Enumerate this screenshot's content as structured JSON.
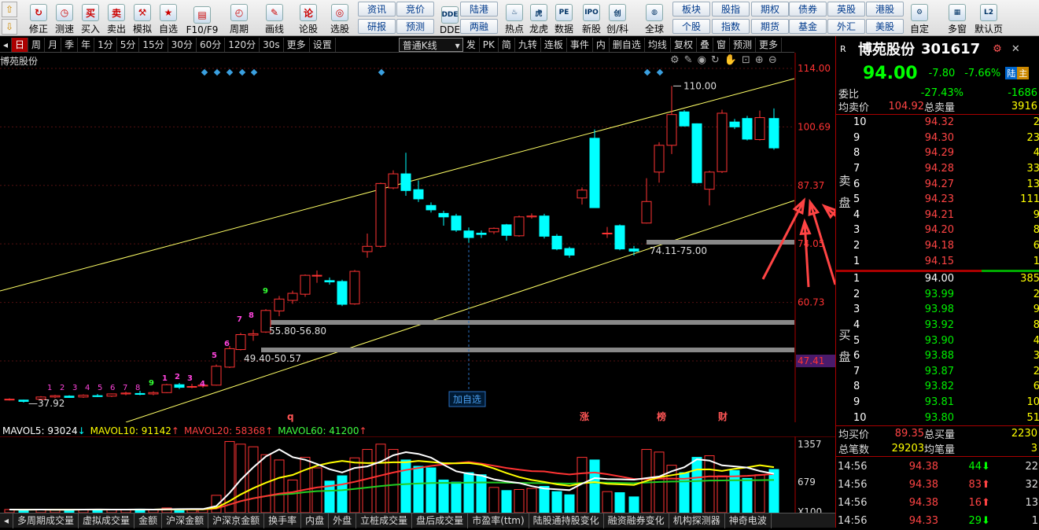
{
  "toolbar": {
    "buttons": [
      {
        "label": "修正",
        "icon": "refresh-icon",
        "glyph": "↻"
      },
      {
        "label": "测速",
        "icon": "stopwatch-icon",
        "glyph": "◷"
      },
      {
        "label": "买入",
        "icon": "buy-icon",
        "glyph": "买"
      },
      {
        "label": "卖出",
        "icon": "sell-icon",
        "glyph": "卖"
      },
      {
        "label": "模拟",
        "icon": "gavel-icon",
        "glyph": "⚒"
      },
      {
        "label": "自选",
        "icon": "star-icon",
        "glyph": "★"
      },
      {
        "label": "F10/F9",
        "icon": "f10-icon",
        "glyph": "▤"
      },
      {
        "label": "周期",
        "icon": "clock-icon",
        "glyph": "◴"
      },
      {
        "label": "画线",
        "icon": "pencil-icon",
        "glyph": "✎"
      },
      {
        "label": "论股",
        "icon": "discuss-icon",
        "glyph": "论"
      },
      {
        "label": "选股",
        "icon": "select-icon",
        "glyph": "◎"
      }
    ],
    "grid_buttons": [
      {
        "label": "资讯"
      },
      {
        "label": "竞价"
      },
      {
        "label": "研报"
      },
      {
        "label": "预测"
      },
      {
        "label": "陆港"
      },
      {
        "label": "两融"
      },
      {
        "label": "板块"
      },
      {
        "label": "股指"
      },
      {
        "label": "期权"
      },
      {
        "label": "债券"
      },
      {
        "label": "英股"
      },
      {
        "label": "港股"
      },
      {
        "label": "个股"
      },
      {
        "label": "指数"
      },
      {
        "label": "期货"
      },
      {
        "label": "基金"
      },
      {
        "label": "外汇"
      },
      {
        "label": "美股"
      }
    ],
    "icon_buttons_2": [
      {
        "label": "DDE",
        "glyph": "DDE"
      },
      {
        "label": "热点",
        "glyph": "♨"
      },
      {
        "label": "龙虎",
        "glyph": "虎"
      },
      {
        "label": "数据",
        "glyph": "PE"
      },
      {
        "label": "新股",
        "glyph": "IPO"
      },
      {
        "label": "创/科",
        "glyph": "创"
      },
      {
        "label": "全球",
        "glyph": "◍"
      },
      {
        "label": "自定",
        "glyph": "⚙"
      },
      {
        "label": "多窗",
        "glyph": "▦"
      },
      {
        "label": "默认页",
        "glyph": "L2"
      }
    ]
  },
  "period_bar": {
    "items": [
      "日",
      "周",
      "月",
      "季",
      "年",
      "1分",
      "5分",
      "15分",
      "30分",
      "60分",
      "120分",
      "30s",
      "更多",
      "设置"
    ],
    "active": "日",
    "kline_select": "普通K线",
    "right_items": [
      "发",
      "PK",
      "简",
      "九转",
      "连板",
      "事件",
      "内",
      "删自选",
      "均线",
      "复权",
      "叠",
      "窗",
      "预测",
      "更多"
    ]
  },
  "chart": {
    "stock_short": "博苑股份",
    "price_axis": [
      "114.00",
      "100.69",
      "87.37",
      "74.05",
      "60.73",
      "47.41"
    ],
    "price_marker": "47.41",
    "annotations": {
      "high": "110.00",
      "low": "37.92",
      "zone1": "74.11-75.00",
      "zone2": "55.80-56.80",
      "zone3": "49.40-50.57",
      "add_watch": "加自选"
    },
    "td_counts_pink": [
      "1",
      "2",
      "3",
      "4",
      "5",
      "6",
      "7",
      "8"
    ],
    "td_counts_green": [
      "9",
      "1",
      "2",
      "3",
      "4",
      "5",
      "6",
      "7",
      "8",
      "9"
    ],
    "event_marks": [
      "q",
      "涨",
      "榜",
      "财"
    ]
  },
  "volume": {
    "legend": [
      {
        "label": "MAVOL5: 93024",
        "dir": "↓",
        "color": "#ffffff"
      },
      {
        "label": "MAVOL10: 91142",
        "dir": "↑",
        "color": "#ffff00"
      },
      {
        "label": "MAVOL20: 58368",
        "dir": "↑",
        "color": "#ff4040"
      },
      {
        "label": "MAVOL60: 41200",
        "dir": "↑",
        "color": "#40ff40"
      }
    ],
    "axis": [
      "1357",
      "679",
      "X100"
    ]
  },
  "bottom_tabs": [
    "多周期成交量",
    "虚拟成交量",
    "金额",
    "沪深金额",
    "沪深京金额",
    "换手率",
    "内盘",
    "外盘",
    "立桩成交量",
    "盘后成交量",
    "市盈率(ttm)",
    "陆股通持股变化",
    "融资融券变化",
    "机构探测器",
    "神奇电波"
  ],
  "quote": {
    "flag": "R",
    "name": "博苑股份",
    "code": "301617",
    "price": "94.00",
    "change": "-7.80",
    "pct": "-7.66%",
    "tag1": "陆",
    "tag2": "主",
    "weibi_label": "委比",
    "weibi": "-27.43%",
    "weicha": "-1686",
    "avg_sell_label": "均卖价",
    "avg_sell": "104.92",
    "total_sell_label": "总卖量",
    "total_sell": "3916",
    "sell_side_label": "卖盘",
    "buy_side_label": "买盘",
    "sell": [
      {
        "lv": "10",
        "p": "94.32",
        "v": "2"
      },
      {
        "lv": "9",
        "p": "94.30",
        "v": "23"
      },
      {
        "lv": "8",
        "p": "94.29",
        "v": "4"
      },
      {
        "lv": "7",
        "p": "94.28",
        "v": "33"
      },
      {
        "lv": "6",
        "p": "94.27",
        "v": "13"
      },
      {
        "lv": "5",
        "p": "94.23",
        "v": "111"
      },
      {
        "lv": "4",
        "p": "94.21",
        "v": "9"
      },
      {
        "lv": "3",
        "p": "94.20",
        "v": "8"
      },
      {
        "lv": "2",
        "p": "94.18",
        "v": "6"
      },
      {
        "lv": "1",
        "p": "94.15",
        "v": "1"
      }
    ],
    "buy": [
      {
        "lv": "1",
        "p": "94.00",
        "v": "385"
      },
      {
        "lv": "2",
        "p": "93.99",
        "v": "2"
      },
      {
        "lv": "3",
        "p": "93.98",
        "v": "9"
      },
      {
        "lv": "4",
        "p": "93.92",
        "v": "8"
      },
      {
        "lv": "5",
        "p": "93.90",
        "v": "4"
      },
      {
        "lv": "6",
        "p": "93.88",
        "v": "3"
      },
      {
        "lv": "7",
        "p": "93.87",
        "v": "2"
      },
      {
        "lv": "8",
        "p": "93.82",
        "v": "6"
      },
      {
        "lv": "9",
        "p": "93.81",
        "v": "10"
      },
      {
        "lv": "10",
        "p": "93.80",
        "v": "51"
      }
    ],
    "avg_buy_label": "均买价",
    "avg_buy": "89.35",
    "total_buy_label": "总买量",
    "total_buy": "2230",
    "total_trades_label": "总笔数",
    "total_trades": "29203",
    "avg_vol_label": "均笔量",
    "avg_vol": "3",
    "ticks": [
      {
        "t": "14:56",
        "p": "94.38",
        "v": "44",
        "d": "down",
        "n": "22"
      },
      {
        "t": "14:56",
        "p": "94.38",
        "v": "83",
        "d": "up",
        "n": "32"
      },
      {
        "t": "14:56",
        "p": "94.38",
        "v": "16",
        "d": "up",
        "n": "13"
      },
      {
        "t": "14:56",
        "p": "94.33",
        "v": "29",
        "d": "down",
        "n": "1"
      }
    ]
  },
  "colors": {
    "up": "#ff3333",
    "down": "#00ffff",
    "accent": "#a00000",
    "yellow": "#ffff00"
  }
}
